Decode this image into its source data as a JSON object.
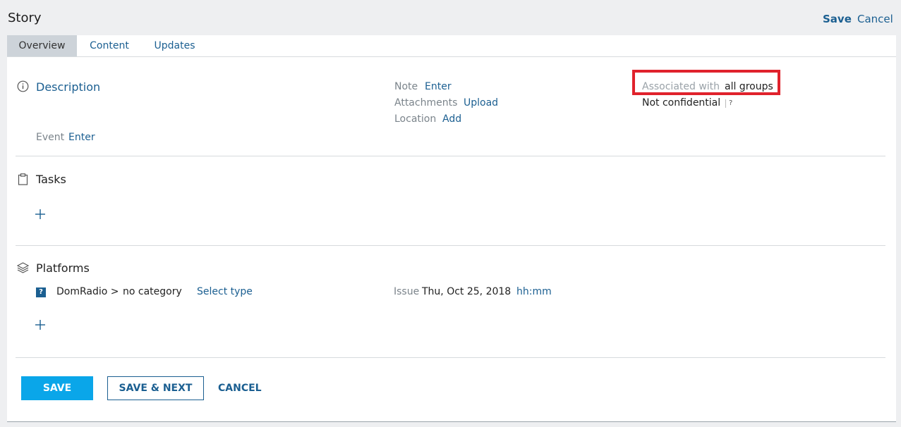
{
  "header": {
    "title": "Story",
    "save_label": "Save",
    "cancel_label": "Cancel"
  },
  "tabs": [
    {
      "label": "Overview"
    },
    {
      "label": "Content"
    },
    {
      "label": "Updates"
    }
  ],
  "description": {
    "title": "Description",
    "event_label": "Event",
    "event_action": "Enter"
  },
  "meta": {
    "note_label": "Note",
    "note_action": "Enter",
    "attachments_label": "Attachments",
    "attachments_action": "Upload",
    "location_label": "Location",
    "location_action": "Add"
  },
  "association": {
    "label": "Associated with",
    "value": "all groups",
    "confidential": "Not confidential",
    "help": "?"
  },
  "tasks": {
    "title": "Tasks"
  },
  "platforms": {
    "title": "Platforms",
    "rows": [
      {
        "badge": "?",
        "name": "DomRadio >",
        "category": "no category",
        "type_action": "Select type",
        "issue_label": "Issue",
        "issue_date": "Thu, Oct 25, 2018",
        "issue_time": "hh:mm"
      }
    ]
  },
  "footer": {
    "save_label": "SAVE",
    "save_next_label": "SAVE & NEXT",
    "cancel_label": "CANCEL"
  },
  "colors": {
    "link": "#1b5f91",
    "primary_button": "#0aa6e9",
    "highlight_box": "#e0222c"
  }
}
